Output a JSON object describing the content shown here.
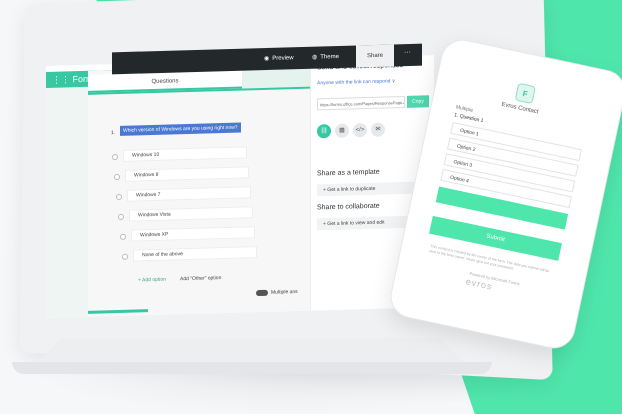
{
  "topbar": {
    "forms_label": "Forms",
    "preview_label": "Preview",
    "theme_label": "Theme",
    "share_label": "Share",
    "more_label": "···"
  },
  "questions": {
    "tab_label": "Questions",
    "number": "1.",
    "question_text": "Which version of Windows are you using right now?",
    "options": [
      "Windows 10",
      "Windows 8",
      "Windows 7",
      "Windows Vista",
      "Windows XP",
      "None of the above"
    ],
    "add_option": "+ Add option",
    "add_other": "Add \"Other\" option",
    "multiple_answers": "Multiple ans"
  },
  "share": {
    "title": "Send and collect responses",
    "audience": "Anyone with the link can respond ∨",
    "url": "https://forms.office.com/Pages/ResponsePage.aspx",
    "copy_label": "Copy",
    "icons": [
      "link-icon",
      "qr-icon",
      "embed-icon",
      "email-icon"
    ],
    "template_heading": "Share as a template",
    "template_link": "+ Get a link to duplicate",
    "collab_heading": "Share to collaborate",
    "collab_link": "+ Get a link to view and edit"
  },
  "phone": {
    "logo": "F",
    "title": "Evros Contact",
    "field": "Multiple",
    "question": "1. Question 1",
    "options": [
      "Option 1",
      "Option 2",
      "Option 3",
      "Option 4"
    ],
    "submit": "Submit",
    "footer": "This content is created by the owner of the form. The data you submit will be sent to the form owner. Never give out your password.",
    "powered": "Powered by Microsoft Forms",
    "brand": "evros"
  },
  "colors": {
    "accent": "#37c7a2",
    "background_shape": "#4fe6ac",
    "dark_bar": "#23282b",
    "highlight": "#4a78d2"
  }
}
